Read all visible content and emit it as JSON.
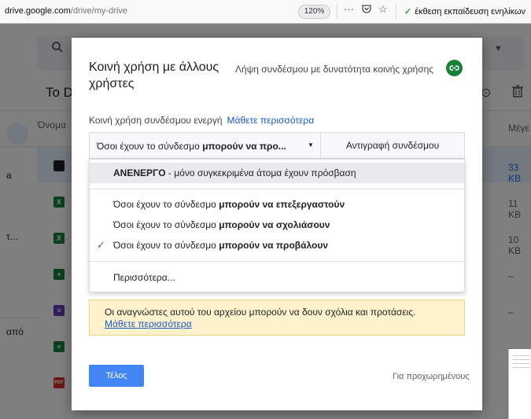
{
  "browser": {
    "url_domain": "drive.google.com",
    "url_path": "/drive/my-drive",
    "zoom": "120%",
    "menu_glyph": "···",
    "bookmark": "έκθεση εκπαίδευση ενηλίκων"
  },
  "drive": {
    "title_partial": "To D",
    "col_name": "Όνομα",
    "col_size": "Μέγε",
    "left_labels": [
      "a",
      "τ...",
      "από"
    ],
    "rows": [
      {
        "icon": "zip",
        "color": "#202124",
        "size": "33 KB",
        "selected": true
      },
      {
        "icon": "excel",
        "color": "#188038",
        "size": "11 KB"
      },
      {
        "icon": "excel",
        "color": "#188038",
        "size": "10 KB"
      },
      {
        "icon": "sheets",
        "color": "#188038",
        "size": "–"
      },
      {
        "icon": "forms",
        "color": "#673ab7",
        "size": "–"
      },
      {
        "icon": "sheets",
        "color": "#188038",
        "size": "–"
      },
      {
        "icon": "pdf",
        "color": "#d93025",
        "size": ""
      }
    ]
  },
  "dialog": {
    "title": "Κοινή χρήση με άλλους χρήστες",
    "get_link": "Λήψη συνδέσμου με δυνατότητα κοινής χρήσης",
    "link_status": "Κοινή χρήση συνδέσμου ενεργή",
    "learn_more": "Μάθετε περισσότερα",
    "dropdown_prefix": "Όσοι έχουν το σύνδεσμο ",
    "dropdown_bold": "μπορούν να προ...",
    "copy_link": "Αντιγραφή συνδέσμου",
    "menu": {
      "off_bold": "ΑΝΕΝΕΡΓΟ",
      "off_rest": " - μόνο συγκεκριμένα άτομα έχουν πρόσβαση",
      "options": [
        {
          "prefix": "Όσοι έχουν το σύνδεσμο ",
          "bold": "μπορούν να επεξεργαστούν",
          "checked": false
        },
        {
          "prefix": "Όσοι έχουν το σύνδεσμο ",
          "bold": "μπορούν να σχολιάσουν",
          "checked": false
        },
        {
          "prefix": "Όσοι έχουν το σύνδεσμο ",
          "bold": "μπορούν να προβάλουν",
          "checked": true
        }
      ],
      "more": "Περισσότερα..."
    },
    "notice_text": "Οι αναγνώστες αυτού του αρχείου μπορούν να δουν σχόλια και προτάσεις.",
    "notice_link": "Μάθετε περισσότερα",
    "done": "Τέλος",
    "advanced": "Για προχωρημένους"
  },
  "icons": {
    "search": "search-icon",
    "link": "link-icon",
    "check": "checkmark-icon",
    "caret": "caret-down-icon"
  }
}
